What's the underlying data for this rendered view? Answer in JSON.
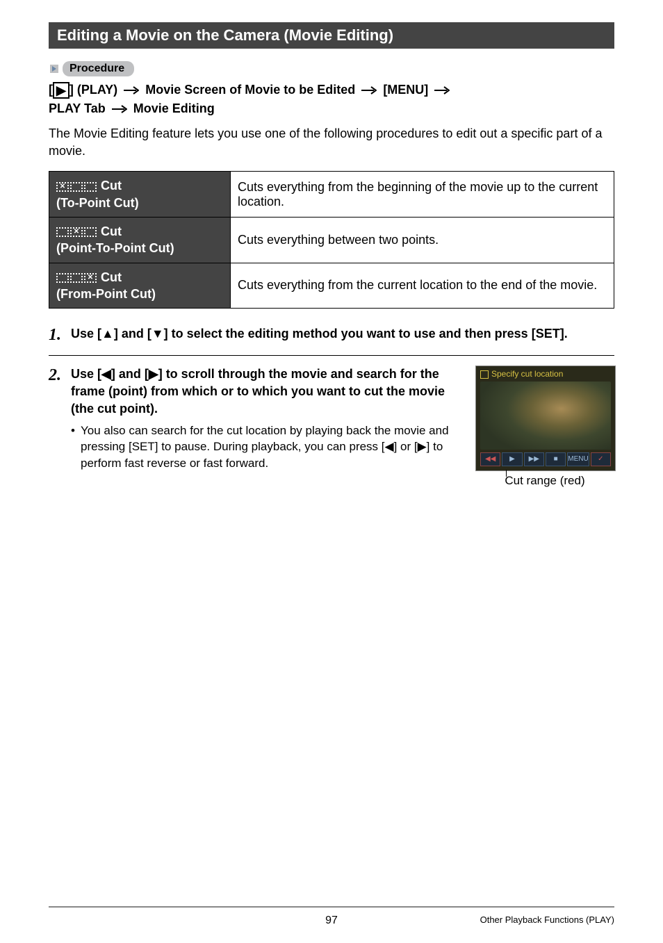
{
  "section_title": "Editing a Movie on the Camera (Movie Editing)",
  "procedure_label": "Procedure",
  "breadcrumb": {
    "part1_prefix": "[",
    "part1_icon_name": "play-icon",
    "part1_suffix": "] (PLAY)",
    "part2": "Movie Screen of Movie to be Edited",
    "part3": "[MENU]",
    "part4": "PLAY Tab",
    "part5": "Movie Editing"
  },
  "intro": "The Movie Editing feature lets you use one of the following procedures to edit out a specific part of a movie.",
  "cuts": [
    {
      "title_line1": "Cut",
      "title_line2": "(To-Point Cut)",
      "desc": "Cuts everything from the beginning of the movie up to the current location."
    },
    {
      "title_line1": "Cut",
      "title_line2": "(Point-To-Point Cut)",
      "desc": "Cuts everything between two points."
    },
    {
      "title_line1": "Cut",
      "title_line2": "(From-Point Cut)",
      "desc": "Cuts everything from the current location to the end of the movie."
    }
  ],
  "steps": {
    "s1": {
      "num": "1.",
      "title": "Use [▲] and [▼] to select the editing method you want to use and then press [SET]."
    },
    "s2": {
      "num": "2.",
      "title": "Use [◀] and [▶] to scroll through the movie and search for the frame (point) from which or to which you want to cut the movie (the cut point).",
      "sub": "You also can search for the cut location by playing back the movie and pressing [SET] to pause. During playback, you can press [◀] or [▶] to perform fast reverse or fast forward."
    }
  },
  "thumbnail": {
    "top_text": "Specify cut location",
    "bar_segments": [
      "◀◀",
      "▶",
      "▶▶",
      "■",
      "MENU",
      "✓"
    ],
    "caption": "Cut range (red)"
  },
  "footer": {
    "page": "97",
    "right": "Other Playback Functions (PLAY)"
  }
}
